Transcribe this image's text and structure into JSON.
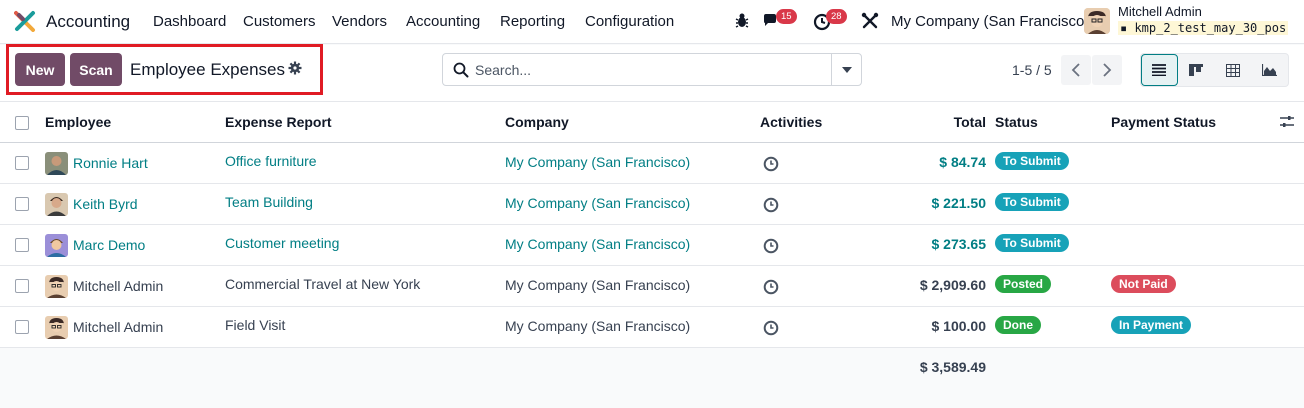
{
  "navbar": {
    "app_title": "Accounting",
    "menus": [
      "Dashboard",
      "Customers",
      "Vendors",
      "Accounting",
      "Reporting",
      "Configuration"
    ],
    "messages_count": "15",
    "activities_count": "28",
    "company": "My Company (San Francisco)",
    "user_name": "Mitchell Admin",
    "db_name": "kmp_2_test_may_30_pos"
  },
  "control_panel": {
    "new_label": "New",
    "scan_label": "Scan",
    "title": "Employee Expenses",
    "search_placeholder": "Search...",
    "pager": "1-5 / 5"
  },
  "table": {
    "headers": {
      "employee": "Employee",
      "expense_report": "Expense Report",
      "company": "Company",
      "activities": "Activities",
      "total": "Total",
      "status": "Status",
      "payment_status": "Payment Status"
    },
    "rows": [
      {
        "employee": "Ronnie Hart",
        "report": "Office furniture",
        "company": "My Company (San Francisco)",
        "total": "$ 84.74",
        "status": "To Submit",
        "payment": ""
      },
      {
        "employee": "Keith Byrd",
        "report": "Team Building",
        "company": "My Company (San Francisco)",
        "total": "$ 221.50",
        "status": "To Submit",
        "payment": ""
      },
      {
        "employee": "Marc Demo",
        "report": "Customer meeting",
        "company": "My Company (San Francisco)",
        "total": "$ 273.65",
        "status": "To Submit",
        "payment": ""
      },
      {
        "employee": "Mitchell Admin",
        "report": "Commercial Travel at New York",
        "company": "My Company (San Francisco)",
        "total": "$ 2,909.60",
        "status": "Posted",
        "payment": "Not Paid"
      },
      {
        "employee": "Mitchell Admin",
        "report": "Field Visit",
        "company": "My Company (San Francisco)",
        "total": "$ 100.00",
        "status": "Done",
        "payment": "In Payment"
      }
    ],
    "grand_total": "$ 3,589.49"
  },
  "colors": {
    "brand": "#714b67",
    "link": "#017e84",
    "to_submit": "#17a2b8",
    "posted": "#28a745",
    "done": "#28a745",
    "not_paid": "#dc4c5c",
    "in_payment": "#17a2b8"
  }
}
